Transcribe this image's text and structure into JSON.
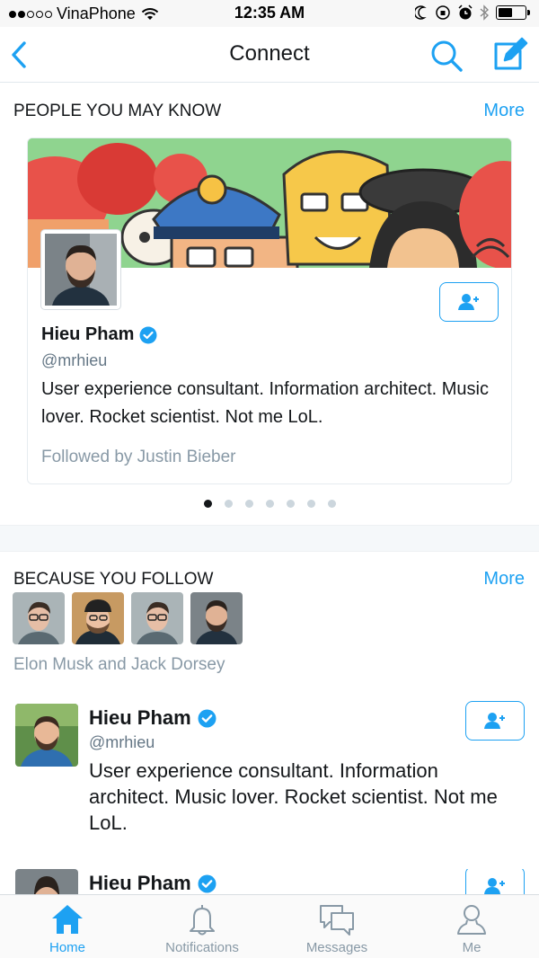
{
  "status_bar": {
    "carrier": "VinaPhone",
    "time": "12:35 AM"
  },
  "nav": {
    "title": "Connect",
    "back_icon": "chevron-left-icon",
    "search_icon": "search-icon",
    "compose_icon": "compose-icon"
  },
  "people_you_may_know": {
    "header": "PEOPLE YOU MAY KNOW",
    "more": "More",
    "card": {
      "name": "Hieu Pham",
      "handle": "@mrhieu",
      "bio": "User experience consultant. Information architect. Music lover. Rocket scientist. Not me LoL.",
      "followed_by": "Followed by Justin Bieber"
    },
    "page_count": 7,
    "active_page": 1
  },
  "because_you_follow": {
    "header": "BECAUSE YOU FOLLOW",
    "more": "More",
    "names": "Elon Musk and Jack Dorsey",
    "users": [
      {
        "name": "Hieu Pham",
        "handle": "@mrhieu",
        "bio": "User experience consultant. Information architect. Music lover. Rocket scientist. Not me LoL."
      },
      {
        "name": "Hieu Pham"
      }
    ]
  },
  "tabs": [
    {
      "label": "Home",
      "icon": "home-icon",
      "active": true
    },
    {
      "label": "Notifications",
      "icon": "bell-icon",
      "active": false
    },
    {
      "label": "Messages",
      "icon": "messages-icon",
      "active": false
    },
    {
      "label": "Me",
      "icon": "person-icon",
      "active": false
    }
  ],
  "colors": {
    "accent": "#1da1f2",
    "text": "#14171a",
    "secondary_text": "#8899a6",
    "verified": "#1da1f2"
  }
}
